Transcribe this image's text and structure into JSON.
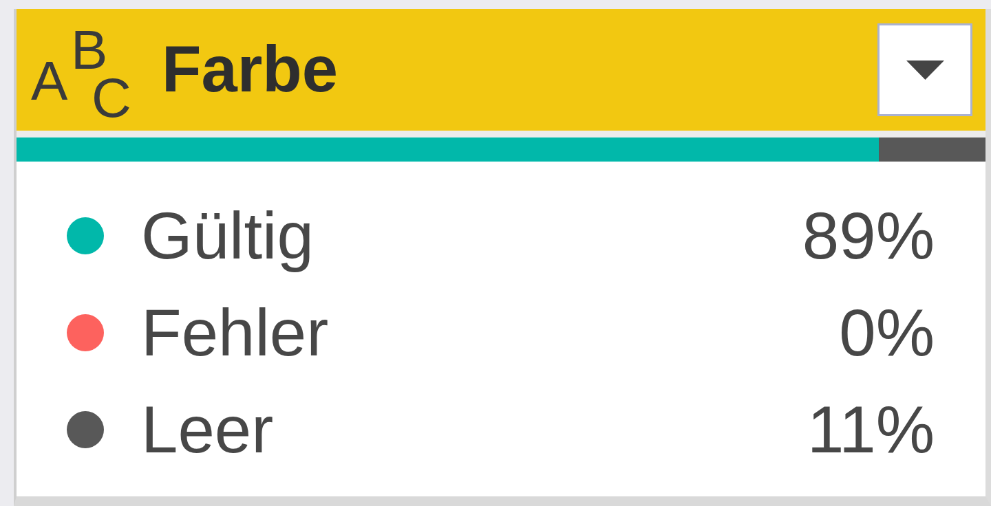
{
  "column_header": {
    "type_indicator": "ABC",
    "title": "Farbe"
  },
  "quality": [
    {
      "label": "Gültig",
      "value": "89%",
      "color": "#01b8aa",
      "level": 0.89
    },
    {
      "label": "Fehler",
      "value": "0%",
      "color": "#fd625e",
      "level": 0
    },
    {
      "label": "Leer",
      "value": "11%",
      "color": "#585858",
      "level": 0.11
    }
  ]
}
